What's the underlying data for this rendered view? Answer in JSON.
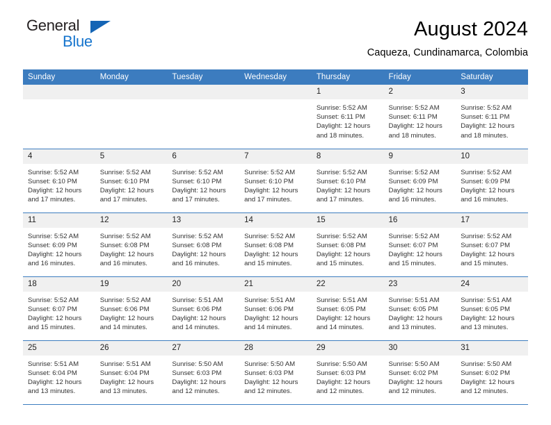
{
  "brand": {
    "name_part1": "General",
    "name_part2": "Blue",
    "accent_color": "#1574cd",
    "triangle_color": "#1565b5"
  },
  "header": {
    "title": "August 2024",
    "subtitle": "Caqueza, Cundinamarca, Colombia"
  },
  "calendar": {
    "header_bg": "#3c7cbf",
    "daynum_bg": "#f0f0f0",
    "weekdays": [
      "Sunday",
      "Monday",
      "Tuesday",
      "Wednesday",
      "Thursday",
      "Friday",
      "Saturday"
    ],
    "weeks": [
      [
        {
          "day": "",
          "lines": []
        },
        {
          "day": "",
          "lines": []
        },
        {
          "day": "",
          "lines": []
        },
        {
          "day": "",
          "lines": []
        },
        {
          "day": "1",
          "lines": [
            "Sunrise: 5:52 AM",
            "Sunset: 6:11 PM",
            "Daylight: 12 hours",
            "and 18 minutes."
          ]
        },
        {
          "day": "2",
          "lines": [
            "Sunrise: 5:52 AM",
            "Sunset: 6:11 PM",
            "Daylight: 12 hours",
            "and 18 minutes."
          ]
        },
        {
          "day": "3",
          "lines": [
            "Sunrise: 5:52 AM",
            "Sunset: 6:11 PM",
            "Daylight: 12 hours",
            "and 18 minutes."
          ]
        }
      ],
      [
        {
          "day": "4",
          "lines": [
            "Sunrise: 5:52 AM",
            "Sunset: 6:10 PM",
            "Daylight: 12 hours",
            "and 17 minutes."
          ]
        },
        {
          "day": "5",
          "lines": [
            "Sunrise: 5:52 AM",
            "Sunset: 6:10 PM",
            "Daylight: 12 hours",
            "and 17 minutes."
          ]
        },
        {
          "day": "6",
          "lines": [
            "Sunrise: 5:52 AM",
            "Sunset: 6:10 PM",
            "Daylight: 12 hours",
            "and 17 minutes."
          ]
        },
        {
          "day": "7",
          "lines": [
            "Sunrise: 5:52 AM",
            "Sunset: 6:10 PM",
            "Daylight: 12 hours",
            "and 17 minutes."
          ]
        },
        {
          "day": "8",
          "lines": [
            "Sunrise: 5:52 AM",
            "Sunset: 6:10 PM",
            "Daylight: 12 hours",
            "and 17 minutes."
          ]
        },
        {
          "day": "9",
          "lines": [
            "Sunrise: 5:52 AM",
            "Sunset: 6:09 PM",
            "Daylight: 12 hours",
            "and 16 minutes."
          ]
        },
        {
          "day": "10",
          "lines": [
            "Sunrise: 5:52 AM",
            "Sunset: 6:09 PM",
            "Daylight: 12 hours",
            "and 16 minutes."
          ]
        }
      ],
      [
        {
          "day": "11",
          "lines": [
            "Sunrise: 5:52 AM",
            "Sunset: 6:09 PM",
            "Daylight: 12 hours",
            "and 16 minutes."
          ]
        },
        {
          "day": "12",
          "lines": [
            "Sunrise: 5:52 AM",
            "Sunset: 6:08 PM",
            "Daylight: 12 hours",
            "and 16 minutes."
          ]
        },
        {
          "day": "13",
          "lines": [
            "Sunrise: 5:52 AM",
            "Sunset: 6:08 PM",
            "Daylight: 12 hours",
            "and 16 minutes."
          ]
        },
        {
          "day": "14",
          "lines": [
            "Sunrise: 5:52 AM",
            "Sunset: 6:08 PM",
            "Daylight: 12 hours",
            "and 15 minutes."
          ]
        },
        {
          "day": "15",
          "lines": [
            "Sunrise: 5:52 AM",
            "Sunset: 6:08 PM",
            "Daylight: 12 hours",
            "and 15 minutes."
          ]
        },
        {
          "day": "16",
          "lines": [
            "Sunrise: 5:52 AM",
            "Sunset: 6:07 PM",
            "Daylight: 12 hours",
            "and 15 minutes."
          ]
        },
        {
          "day": "17",
          "lines": [
            "Sunrise: 5:52 AM",
            "Sunset: 6:07 PM",
            "Daylight: 12 hours",
            "and 15 minutes."
          ]
        }
      ],
      [
        {
          "day": "18",
          "lines": [
            "Sunrise: 5:52 AM",
            "Sunset: 6:07 PM",
            "Daylight: 12 hours",
            "and 15 minutes."
          ]
        },
        {
          "day": "19",
          "lines": [
            "Sunrise: 5:52 AM",
            "Sunset: 6:06 PM",
            "Daylight: 12 hours",
            "and 14 minutes."
          ]
        },
        {
          "day": "20",
          "lines": [
            "Sunrise: 5:51 AM",
            "Sunset: 6:06 PM",
            "Daylight: 12 hours",
            "and 14 minutes."
          ]
        },
        {
          "day": "21",
          "lines": [
            "Sunrise: 5:51 AM",
            "Sunset: 6:06 PM",
            "Daylight: 12 hours",
            "and 14 minutes."
          ]
        },
        {
          "day": "22",
          "lines": [
            "Sunrise: 5:51 AM",
            "Sunset: 6:05 PM",
            "Daylight: 12 hours",
            "and 14 minutes."
          ]
        },
        {
          "day": "23",
          "lines": [
            "Sunrise: 5:51 AM",
            "Sunset: 6:05 PM",
            "Daylight: 12 hours",
            "and 13 minutes."
          ]
        },
        {
          "day": "24",
          "lines": [
            "Sunrise: 5:51 AM",
            "Sunset: 6:05 PM",
            "Daylight: 12 hours",
            "and 13 minutes."
          ]
        }
      ],
      [
        {
          "day": "25",
          "lines": [
            "Sunrise: 5:51 AM",
            "Sunset: 6:04 PM",
            "Daylight: 12 hours",
            "and 13 minutes."
          ]
        },
        {
          "day": "26",
          "lines": [
            "Sunrise: 5:51 AM",
            "Sunset: 6:04 PM",
            "Daylight: 12 hours",
            "and 13 minutes."
          ]
        },
        {
          "day": "27",
          "lines": [
            "Sunrise: 5:50 AM",
            "Sunset: 6:03 PM",
            "Daylight: 12 hours",
            "and 12 minutes."
          ]
        },
        {
          "day": "28",
          "lines": [
            "Sunrise: 5:50 AM",
            "Sunset: 6:03 PM",
            "Daylight: 12 hours",
            "and 12 minutes."
          ]
        },
        {
          "day": "29",
          "lines": [
            "Sunrise: 5:50 AM",
            "Sunset: 6:03 PM",
            "Daylight: 12 hours",
            "and 12 minutes."
          ]
        },
        {
          "day": "30",
          "lines": [
            "Sunrise: 5:50 AM",
            "Sunset: 6:02 PM",
            "Daylight: 12 hours",
            "and 12 minutes."
          ]
        },
        {
          "day": "31",
          "lines": [
            "Sunrise: 5:50 AM",
            "Sunset: 6:02 PM",
            "Daylight: 12 hours",
            "and 12 minutes."
          ]
        }
      ]
    ]
  }
}
